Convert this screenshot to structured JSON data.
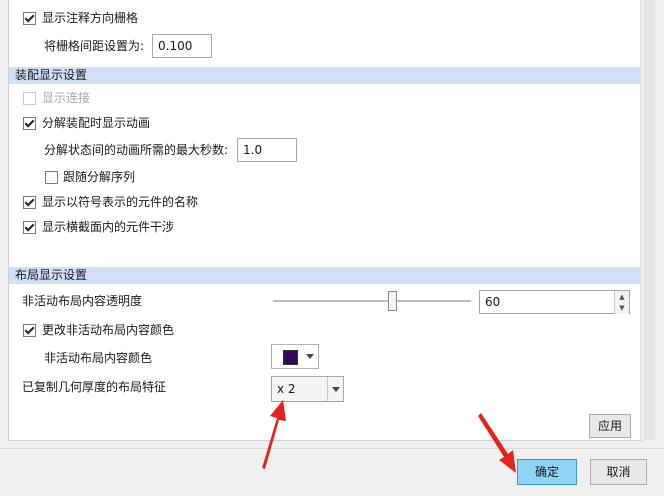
{
  "annotation_grid": {
    "show_grid_label": "显示注释方向栅格",
    "show_grid_checked": true,
    "spacing_label": "将栅格间距设置为:",
    "spacing_value": "0.100"
  },
  "assembly_display": {
    "header": "装配显示设置",
    "show_connections_label": "显示连接",
    "show_connections_checked": false,
    "show_connections_enabled": false,
    "explode_animation_label": "分解装配时显示动画",
    "explode_animation_checked": true,
    "max_seconds_label": "分解状态间的动画所需的最大秒数:",
    "max_seconds_value": "1.0",
    "follow_sequence_label": "跟随分解序列",
    "follow_sequence_checked": false,
    "symbol_names_label": "显示以符号表示的元件的名称",
    "symbol_names_checked": true,
    "xsection_interference_label": "显示横截面内的元件干涉",
    "xsection_interference_checked": true
  },
  "layout_display": {
    "header": "布局显示设置",
    "transparency_label": "非活动布局内容透明度",
    "transparency_value": "60",
    "transparency_slider_fraction": 0.6,
    "change_color_label": "更改非活动布局内容颜色",
    "change_color_checked": true,
    "content_color_label": "非活动布局内容颜色",
    "content_color": "#2d0a5c",
    "copied_geometry_label": "已复制几何厚度的布局特征",
    "copied_geometry_value": "x 2"
  },
  "buttons": {
    "apply": "应用",
    "ok": "确定",
    "cancel": "取消"
  },
  "colors": {
    "section_header_bg": "#cfe0f8",
    "annotation_arrow": "#e0261a",
    "ok_highlight": "#8fd3f5"
  }
}
